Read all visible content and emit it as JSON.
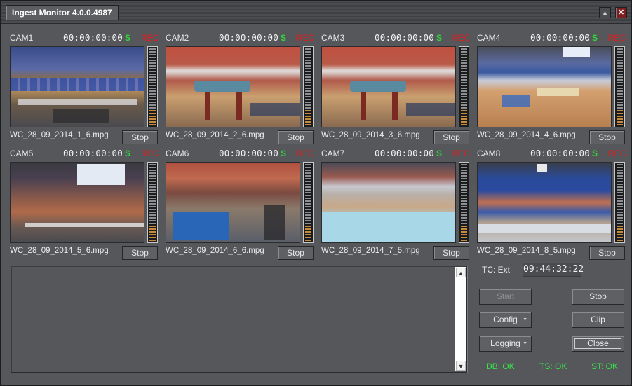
{
  "window": {
    "title": "Ingest Monitor 4.0.0.4987",
    "minimize_icon": "▲",
    "close_icon": "✕"
  },
  "cameras": [
    {
      "label": "CAM1",
      "timecode": "00:00:00:00",
      "s": "S",
      "rec": "REC",
      "file": "WC_28_09_2014_1_6.mpg",
      "stop": "Stop"
    },
    {
      "label": "CAM2",
      "timecode": "00:00:00:00",
      "s": "S",
      "rec": "REC",
      "file": "WC_28_09_2014_2_6.mpg",
      "stop": "Stop"
    },
    {
      "label": "CAM3",
      "timecode": "00:00:00:00",
      "s": "S",
      "rec": "REC",
      "file": "WC_28_09_2014_3_6.mpg",
      "stop": "Stop"
    },
    {
      "label": "CAM4",
      "timecode": "00:00:00:00",
      "s": "S",
      "rec": "REC",
      "file": "WC_28_09_2014_4_6.mpg",
      "stop": "Stop"
    },
    {
      "label": "CAM5",
      "timecode": "00:00:00:00",
      "s": "S",
      "rec": "REC",
      "file": "WC_28_09_2014_5_6.mpg",
      "stop": "Stop"
    },
    {
      "label": "CAM6",
      "timecode": "00:00:00:00",
      "s": "S",
      "rec": "REC",
      "file": "WC_28_09_2014_6_6.mpg",
      "stop": "Stop"
    },
    {
      "label": "CAM7",
      "timecode": "00:00:00:00",
      "s": "S",
      "rec": "REC",
      "file": "WC_28_09_2014_7_5.mpg",
      "stop": "Stop"
    },
    {
      "label": "CAM8",
      "timecode": "00:00:00:00",
      "s": "S",
      "rec": "REC",
      "file": "WC_28_09_2014_8_5.mpg",
      "stop": "Stop"
    }
  ],
  "tc": {
    "label": "TC: Ext",
    "value": "09:44:32:22"
  },
  "buttons": {
    "start": "Start",
    "stop": "Stop",
    "config": "Config",
    "clip": "Clip",
    "logging": "Logging",
    "close": "Close"
  },
  "status": {
    "db": "DB: OK",
    "ts": "TS: OK",
    "st": "ST: OK"
  },
  "colors": {
    "ok": "#38e04a",
    "rec": "#e01e1e",
    "signal": "#2fd83a"
  }
}
